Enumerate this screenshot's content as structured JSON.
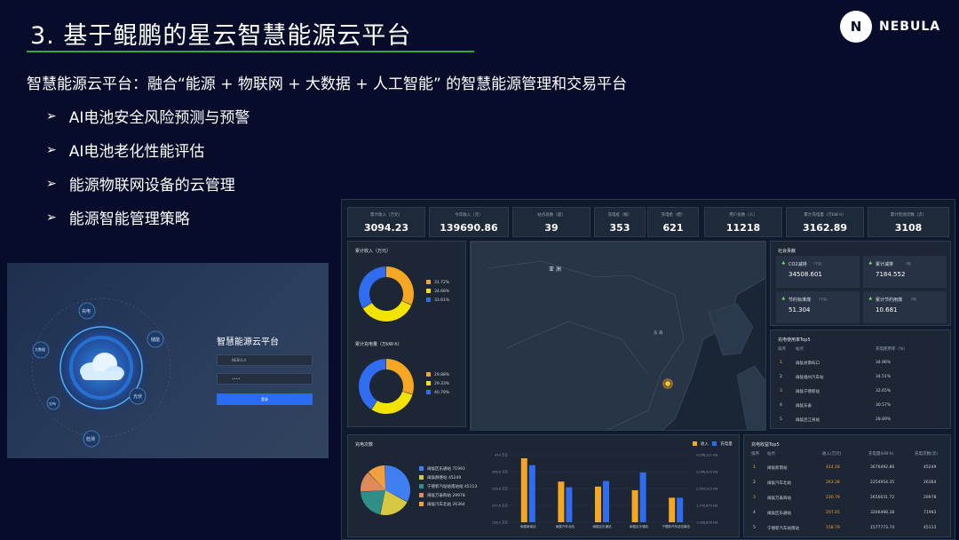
{
  "slide": {
    "title": "3. 基于鲲鹏的星云智慧能源云平台",
    "subtitle": "智慧能源云平台：融合“能源 + 物联网 + 大数据 + 人工智能” 的智慧能源管理和交易平台",
    "bullets": [
      "AI电池安全风险预测与预警",
      "AI电池老化性能评估",
      "能源物联网设备的云管理",
      "能源智能管理策略"
    ],
    "bullet_arrow": "➢"
  },
  "logo": {
    "mark": "N",
    "text": "NEBULA"
  },
  "colors": {
    "accent_green": "#27b03a",
    "orange": "#f5a623",
    "yellow": "#f2e300",
    "blue": "#2f6cf0"
  },
  "login": {
    "title": "智慧能源云平台",
    "username": "NEBULA",
    "password": "••••",
    "button": "登录",
    "orbit_labels": [
      "充电",
      "储能",
      "光伏",
      "检测",
      "大数据",
      "分布"
    ]
  },
  "dashboard": {
    "kpis": [
      {
        "label": "累计收入（万元）",
        "value": "3094.23"
      },
      {
        "label": "今年收入（元）",
        "value": "139690.86"
      },
      {
        "label": "站点总数（座）",
        "value": "39"
      },
      {
        "label": "充电桩（根）",
        "value": "353"
      },
      {
        "label": "充电枪（把）",
        "value": "621"
      },
      {
        "label": "用户总数（人）",
        "value": "11218"
      },
      {
        "label": "累计充电量（万kW·h）",
        "value": "3162.89"
      },
      {
        "label": "累计检测次数（次）",
        "value": "3108"
      }
    ],
    "income_donut": {
      "title": "累计收入（万元）",
      "slices": [
        {
          "label": "31.72%",
          "value": 31.72,
          "color": "#f5a623"
        },
        {
          "label": "34.68%",
          "value": 34.68,
          "color": "#f2e300"
        },
        {
          "label": "33.61%",
          "value": 33.61,
          "color": "#2f6cf0"
        }
      ]
    },
    "energy_donut": {
      "title": "累计充电量（万kW·h）",
      "slices": [
        {
          "label": "29.88%",
          "value": 29.88,
          "color": "#f5a623"
        },
        {
          "label": "29.33%",
          "value": 29.33,
          "color": "#f2e300"
        },
        {
          "label": "40.79%",
          "value": 40.79,
          "color": "#2f6cf0"
        }
      ]
    },
    "map": {
      "label_asia": "亚 洲",
      "label_sea": "东 海"
    },
    "savings": {
      "title": "社会贡献",
      "items": [
        {
          "label": "CO2减排",
          "unit": "（千克）",
          "value": "34508.601"
        },
        {
          "label": "累计减排",
          "unit": "（吨）",
          "value": "7184.552"
        },
        {
          "label": "节约标准煤",
          "unit": "（千克）",
          "value": "51.304"
        },
        {
          "label": "累计节约用煤",
          "unit": "（吨）",
          "value": "10.681"
        }
      ]
    },
    "usage_top5": {
      "title": "充电使用率Top5",
      "headers": [
        "排序",
        "站点",
        "充电使用率（%）"
      ],
      "rows": [
        {
          "rank": "1",
          "name": "闽侯县南屿口",
          "value": "34.96%"
        },
        {
          "rank": "2",
          "name": "闽侯福州汽车站",
          "value": "34.51%"
        },
        {
          "rank": "3",
          "name": "闽侯宁德新站",
          "value": "32.65%"
        },
        {
          "rank": "4",
          "name": "闽侯东泰",
          "value": "30.57%"
        },
        {
          "rank": "5",
          "name": "闽侯连江县站",
          "value": "28.89%"
        }
      ]
    },
    "charge_count": {
      "title": "充电次数",
      "pie_legend": [
        {
          "name": "闽侯区乐通站",
          "value": "71993"
        },
        {
          "name": "闽侯群德站",
          "value": "45249"
        },
        {
          "name": "宁德新汽站站南站站",
          "value": "45113"
        },
        {
          "name": "闽侯万泰购站",
          "value": "29978"
        },
        {
          "name": "闽侯汽车北站",
          "value": "26364"
        }
      ],
      "bar_legend": [
        "收入",
        "充电量"
      ],
      "bar_groups": [
        "闽侯新南站",
        "闽侯汽车北站",
        "闽侯区乐通站",
        "闽侯区乐通站",
        "宁德新汽车站站南站"
      ]
    },
    "income_top5": {
      "title": "充电收益Top5",
      "headers": [
        "排序",
        "站点",
        "收入(万元)",
        "充电量(kW·h)",
        "充电次数(次)"
      ],
      "rows": [
        {
          "rank": "1",
          "name": "闽侯新南站",
          "income": "414.18",
          "energy": "3676492.86",
          "count": "45249"
        },
        {
          "rank": "2",
          "name": "闽侯汽车北站",
          "income": "263.28",
          "energy": "2254954.35",
          "count": "26364"
        },
        {
          "rank": "3",
          "name": "闽侯万泰商站",
          "income": "230.79",
          "energy": "2656031.72",
          "count": "29978"
        },
        {
          "rank": "4",
          "name": "闽侯区乐通站",
          "income": "207.45",
          "energy": "3206498.38",
          "count": "71993"
        },
        {
          "rank": "5",
          "name": "宁德新汽车站南站",
          "income": "158.79",
          "energy": "1577773.74",
          "count": "45113"
        }
      ]
    }
  },
  "chart_data": [
    {
      "type": "pie",
      "title": "累计收入（万元）",
      "categories": [
        "31.72%",
        "34.68%",
        "33.61%"
      ],
      "values": [
        31.72,
        34.68,
        33.61
      ]
    },
    {
      "type": "pie",
      "title": "累计充电量（万kW·h）",
      "categories": [
        "29.88%",
        "29.33%",
        "40.79%"
      ],
      "values": [
        29.88,
        29.33,
        40.79
      ]
    },
    {
      "type": "pie",
      "title": "充电次数",
      "categories": [
        "闽侯区乐通站",
        "闽侯群德站",
        "宁德新汽站站南站站",
        "闽侯万泰购站",
        "闽侯汽车北站"
      ],
      "values": [
        71993,
        45249,
        45113,
        29978,
        26364
      ]
    },
    {
      "type": "bar",
      "categories": [
        "闽侯新南站",
        "闽侯汽车北站",
        "闽侯区乐通站",
        "闽侯区乐通站",
        "宁德新汽车站站南站"
      ],
      "series": [
        {
          "name": "收入",
          "values": [
            414.18,
            263.28,
            230.79,
            207.45,
            158.79
          ]
        },
        {
          "name": "充电量",
          "values": [
            3676492.86,
            2254954.35,
            2656031.72,
            3206498.38,
            1577773.74
          ]
        }
      ],
      "y_left_ticks": [
        "414 万元",
        "396.6 万元",
        "316.8 万元",
        "237.6 万元",
        "158.4 万元"
      ],
      "y_right_ticks": [
        "4,096,227 kW·h",
        "3,096,929 kW·h",
        "2,505,915 kW·h",
        "1,745,870 kW·h",
        "1,008,826 kW·h"
      ]
    }
  ]
}
